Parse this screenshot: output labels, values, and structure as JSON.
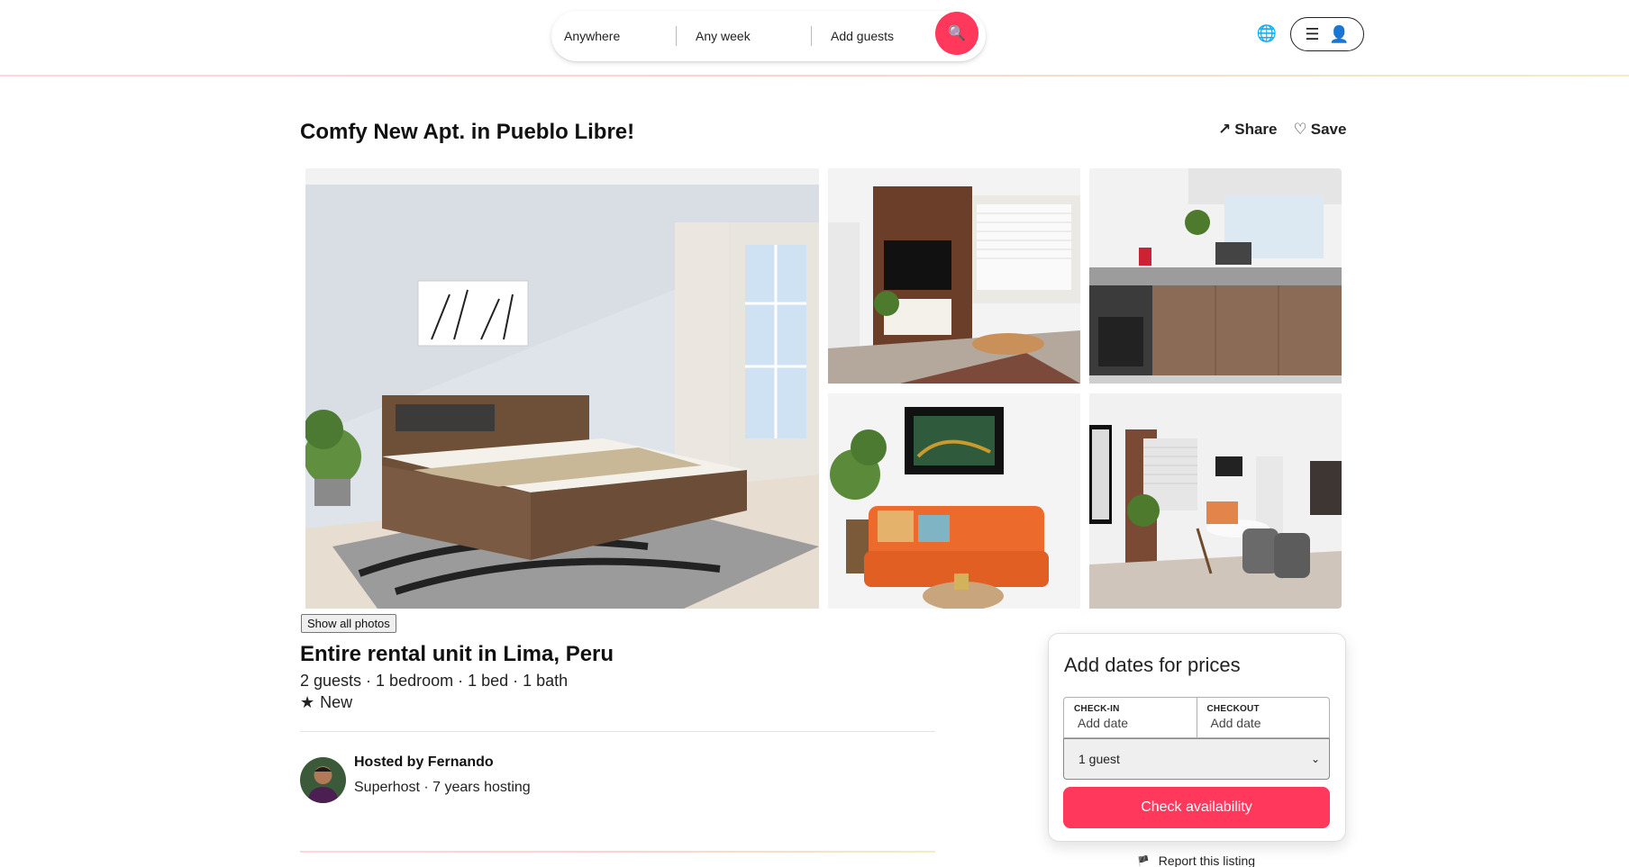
{
  "search": {
    "where": "Anywhere",
    "when": "Any week",
    "who": "Add guests",
    "search_icon": "search-icon"
  },
  "header": {
    "globe_icon": "globe-icon",
    "menu_icon": "hamburger-icon",
    "user_icon": "user-icon",
    "accent_color": "#ff385c"
  },
  "listing": {
    "title": "Comfy New Apt. in Pueblo Libre!",
    "share_label": "Share",
    "save_label": "Save",
    "show_all_photos": "Show all photos",
    "subtitle": "Entire rental unit in Lima, Peru",
    "details": "2 guests · 1 bedroom · 1 bed · 1 bath",
    "rating_star": "★",
    "rating_label": "New"
  },
  "host": {
    "name": "Hosted by Fernando",
    "meta": "Superhost · 7 years hosting"
  },
  "booking": {
    "title": "Add dates for prices",
    "checkin_label": "CHECK-IN",
    "checkin_value": "Add date",
    "checkout_label": "CHECKOUT",
    "checkout_value": "Add date",
    "guests_value": "1 guest",
    "cta_label": "Check availability"
  },
  "report": {
    "label": "Report this listing"
  }
}
